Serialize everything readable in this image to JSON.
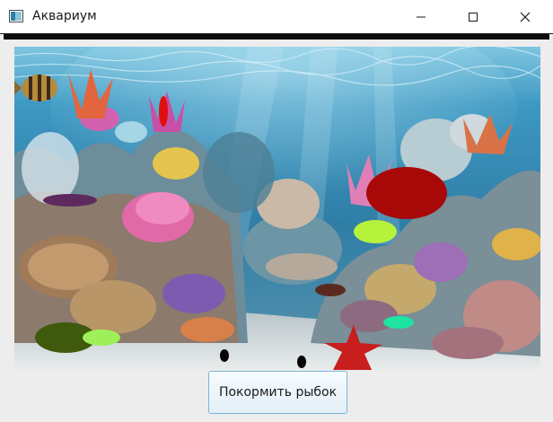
{
  "window": {
    "title": "Аквариум",
    "icon": "app-window-icon",
    "controls": [
      "minimize-icon",
      "maximize-icon",
      "close-icon"
    ]
  },
  "aquarium": {
    "background": "coral-reef-scene"
  },
  "fish": [
    {
      "shape": "ellipse",
      "color": "#5e2a5e"
    },
    {
      "shape": "ellipse",
      "color": "#e01010"
    },
    {
      "shape": "ellipse",
      "color": "#a80808"
    },
    {
      "shape": "ellipse",
      "color": "#b6f23c"
    },
    {
      "shape": "ellipse",
      "color": "#5a2a20"
    },
    {
      "shape": "ellipse",
      "color": "#1de4a0"
    },
    {
      "shape": "ellipse",
      "color": "#3f5a0c"
    },
    {
      "shape": "ellipse",
      "color": "#9ef05a"
    },
    {
      "shape": "ellipse",
      "color": "#050505"
    },
    {
      "shape": "ellipse",
      "color": "#050505"
    }
  ],
  "actions": {
    "feed_label": "Покормить рыбок"
  }
}
